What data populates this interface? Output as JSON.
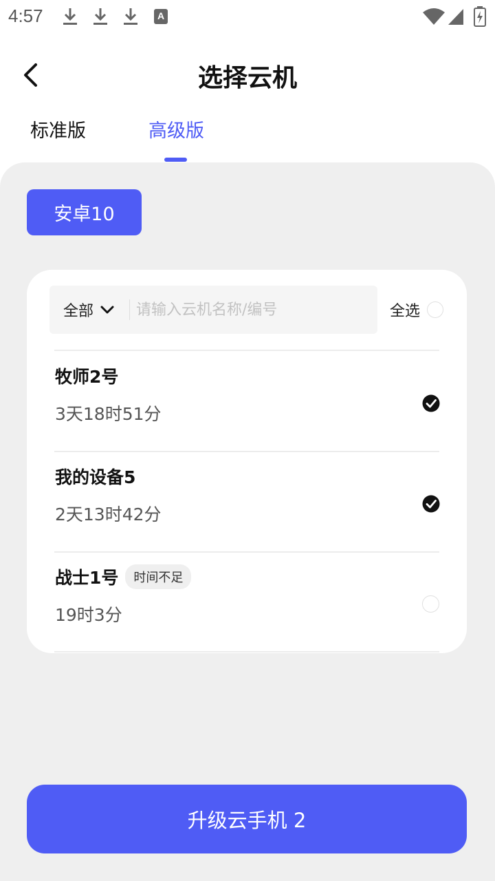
{
  "status_bar": {
    "time": "4:57",
    "icons": [
      "download-icon",
      "download-icon",
      "download-icon",
      "a-icon",
      "wifi-icon",
      "signal-icon",
      "battery-icon"
    ],
    "a_letter": "A"
  },
  "header": {
    "title": "选择云机"
  },
  "tabs": [
    {
      "label": "标准版",
      "active": false
    },
    {
      "label": "高级版",
      "active": true
    }
  ],
  "os_chip": {
    "label": "安卓10"
  },
  "search": {
    "filter_label": "全部",
    "placeholder": "请输入云机名称/编号",
    "value": ""
  },
  "select_all": {
    "label": "全选",
    "checked": false
  },
  "devices": [
    {
      "name": "牧师2号",
      "time": "3天18时51分",
      "badge": "",
      "checked": true
    },
    {
      "name": "我的设备5",
      "time": "2天13时42分",
      "badge": "",
      "checked": true
    },
    {
      "name": "战士1号",
      "time": "19时3分",
      "badge": "时间不足",
      "checked": false
    }
  ],
  "footer": {
    "upgrade_label": "升级云手机 2"
  },
  "colors": {
    "accent": "#4f5cf5",
    "panel_bg": "#efefef",
    "card_bg": "#ffffff"
  }
}
